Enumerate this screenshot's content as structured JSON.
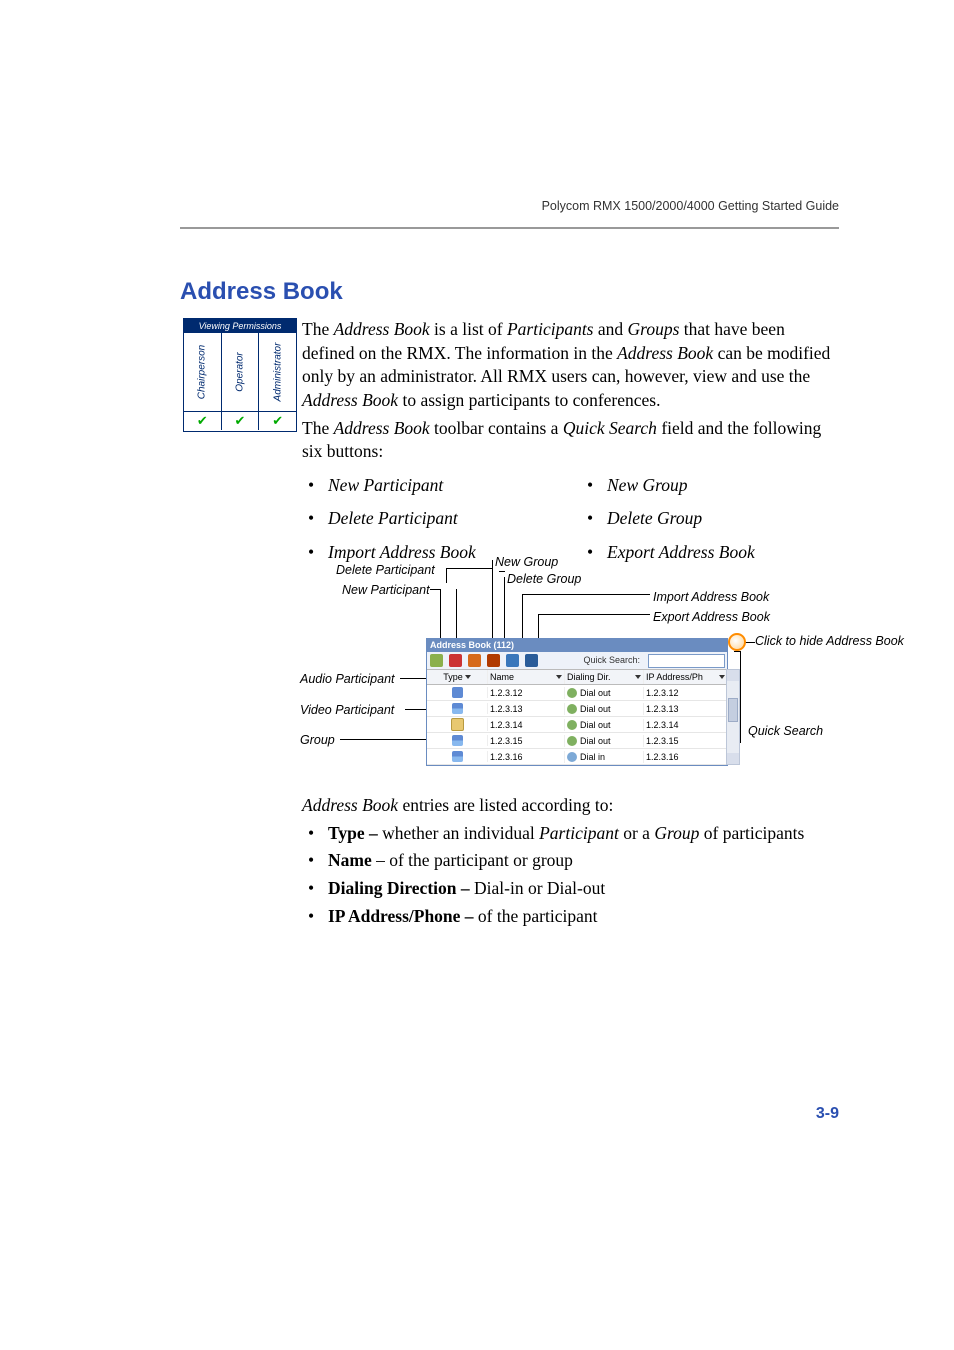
{
  "doc_header": "Polycom RMX 1500/2000/4000 Getting Started Guide",
  "section_title": "Address Book",
  "permissions": {
    "caption": "Viewing Permissions",
    "roles": [
      "Chairperson",
      "Operator",
      "Administrator"
    ],
    "checks": [
      "✔",
      "✔",
      "✔"
    ]
  },
  "intro": {
    "pre": "The ",
    "term1": "Address Book",
    "mid1": " is a list of ",
    "term2": "Participants",
    "mid2": " and ",
    "term3": "Groups",
    "tail1": " that have been defined on the RMX. The information in the ",
    "term4": "Address Book",
    "tail2": " can be modified only by an administrator. All RMX users can, however, view and use the ",
    "term5": "Address Book",
    "tail3": " to assign participants to conferences."
  },
  "toolbar_sentence": {
    "pre": "The ",
    "t1": "Address Book",
    "mid": " toolbar contains a ",
    "t2": "Quick Search",
    "tail": " field and the following six buttons:"
  },
  "buttons": {
    "left": [
      "New Participant",
      "Delete Participant",
      "Import Address Book"
    ],
    "right": [
      "New Group",
      "Delete Group",
      "Export Address Book"
    ]
  },
  "figure": {
    "top_labels": {
      "new_group": "New Group",
      "delete_group": "Delete Group",
      "delete_participant": "Delete Participant",
      "new_participant": "New Participant",
      "import": "Import Address Book",
      "export": "Export Address Book"
    },
    "side_labels": {
      "audio": "Audio Participant",
      "video": "Video Participant",
      "group": "Group",
      "click_hide": "Click to hide Address Book",
      "quick_search": "Quick Search"
    },
    "panel": {
      "title": "Address Book (112)",
      "quick_search_label": "Quick Search:",
      "headers": [
        "Type",
        "Name",
        "Dialing Dir.",
        "IP Address/Ph"
      ],
      "rows": [
        {
          "icon": "audio",
          "name": "1.2.3.12",
          "dir": "Dial out",
          "ip": "1.2.3.12"
        },
        {
          "icon": "video",
          "name": "1.2.3.13",
          "dir": "Dial out",
          "ip": "1.2.3.13"
        },
        {
          "icon": "group",
          "name": "1.2.3.14",
          "dir": "Dial out",
          "ip": "1.2.3.14"
        },
        {
          "icon": "video",
          "name": "1.2.3.15",
          "dir": "Dial out",
          "ip": "1.2.3.15"
        },
        {
          "icon": "video",
          "name": "1.2.3.16",
          "dir": "Dial in",
          "ip": "1.2.3.16"
        }
      ]
    }
  },
  "entries_intro": {
    "t1": "Address Book",
    "tail": " entries are listed according to:"
  },
  "entries_list": [
    {
      "b": "Type – ",
      "p1": "whether an individual ",
      "i1": "Participant",
      "p2": " or a ",
      "i2": "Group",
      "p3": " of participants"
    },
    {
      "b": "Name",
      "p1": " – of the participant or group"
    },
    {
      "b": "Dialing Direction – ",
      "p1": "Dial-in or Dial-out"
    },
    {
      "b": "IP Address/Phone – ",
      "p1": "of the participant"
    }
  ],
  "page_number": "3-9"
}
